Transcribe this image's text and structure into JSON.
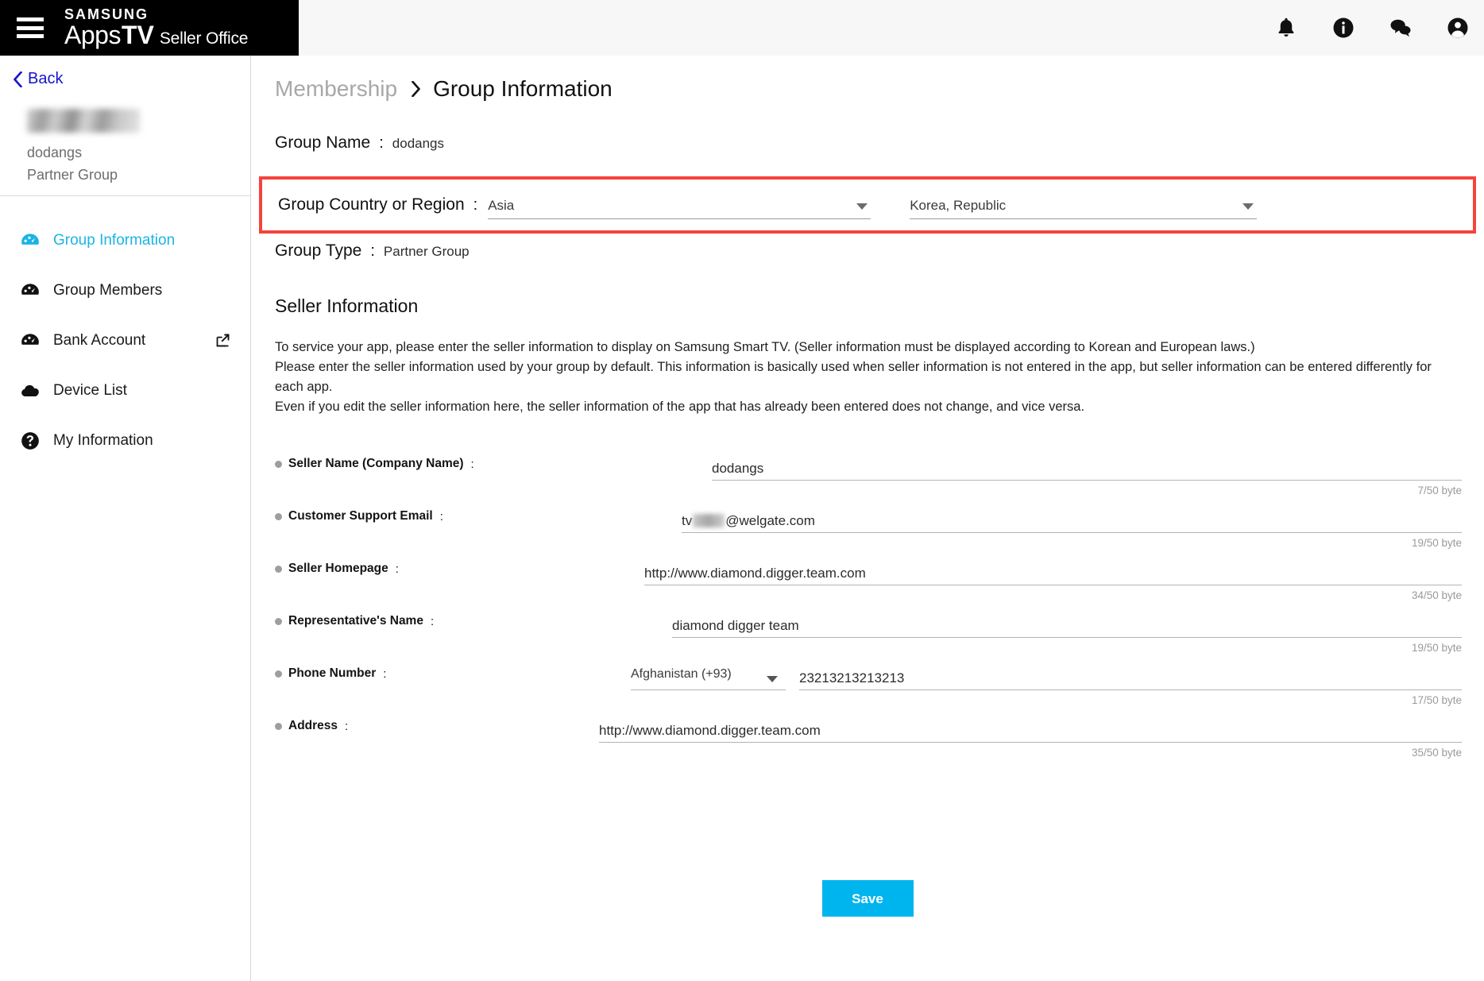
{
  "brand": {
    "samsung": "SAMSUNG",
    "apps": "Apps",
    "tv": "TV",
    "seller_office": "Seller Office"
  },
  "header": {
    "icons": [
      "bell-icon",
      "info-icon",
      "chat-icon",
      "account-icon"
    ]
  },
  "sidebar": {
    "back_label": "Back",
    "group_name": "dodangs",
    "group_type": "Partner Group",
    "items": [
      {
        "label": "Group Information",
        "icon": "dashboard-icon",
        "active": true,
        "external": false
      },
      {
        "label": "Group Members",
        "icon": "dashboard-icon",
        "active": false,
        "external": false
      },
      {
        "label": "Bank Account",
        "icon": "dashboard-icon",
        "active": false,
        "external": true
      },
      {
        "label": "Device List",
        "icon": "cloud-icon",
        "active": false,
        "external": false
      },
      {
        "label": "My Information",
        "icon": "question-circle-icon",
        "active": false,
        "external": false
      }
    ]
  },
  "breadcrumb": {
    "parent": "Membership",
    "current": "Group Information"
  },
  "group": {
    "name_label": "Group Name",
    "name_value": "dodangs",
    "country_label": "Group Country or Region",
    "region_value": "Asia",
    "country_value": "Korea, Republic",
    "type_label": "Group Type",
    "type_value": "Partner Group",
    "highlight_color": "#f4443c"
  },
  "seller": {
    "title": "Seller Information",
    "desc_line1": "To service your app, please enter the seller information to display on Samsung Smart TV. (Seller information must be displayed according to Korean and European laws.)",
    "desc_line2": "Please enter the seller information used by your group by default. This information is basically used when seller information is not entered in the app, but seller information can be entered differently for each app.",
    "desc_line3": "Even if you edit the seller information here, the seller information of the app that has already been entered does not change, and vice versa.",
    "fields": [
      {
        "label": "Seller Name (Company Name)",
        "value": "dodangs",
        "bytes": "7/50 byte"
      },
      {
        "label": "Customer Support Email",
        "value_prefix": "tv",
        "value_suffix": "@welgate.com",
        "redacted": true,
        "bytes": "19/50 byte"
      },
      {
        "label": "Seller Homepage",
        "value": "http://www.diamond.digger.team.com",
        "bytes": "34/50 byte"
      },
      {
        "label": "Representative's Name",
        "value": "diamond digger team",
        "bytes": "19/50 byte"
      },
      {
        "label": "Phone Number",
        "country_code": "Afghanistan (+93)",
        "value": "23213213213213",
        "bytes": "17/50 byte"
      },
      {
        "label": "Address",
        "value": "http://www.diamond.digger.team.com",
        "bytes": "35/50 byte"
      }
    ]
  },
  "footer": {
    "save_label": "Save",
    "save_color": "#00b5ee"
  }
}
